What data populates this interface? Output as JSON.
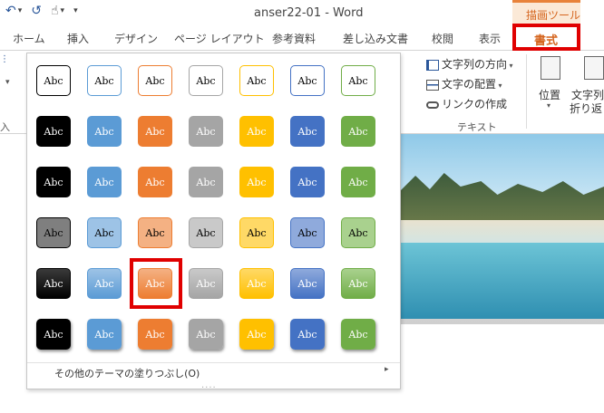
{
  "window": {
    "title": "anser22-01 - Word",
    "context_group": "描画ツール"
  },
  "qat": {
    "undo": "↶",
    "redo": "↺",
    "touch": "☝",
    "more": "▾"
  },
  "tabs": [
    "ホーム",
    "挿入",
    "デザイン",
    "ページ レイアウト",
    "参考資料",
    "差し込み文書",
    "校閲",
    "表示"
  ],
  "active_tab": "書式",
  "ribbon": {
    "text_direction": "文字列の方向",
    "text_align": "文字の配置",
    "create_link": "リンクの作成",
    "text_group": "テキスト",
    "position": "位置",
    "wrap_line1": "文字列",
    "wrap_line2": "折り返し",
    "left_frag": "入"
  },
  "gallery": {
    "swatch_text": "Abc",
    "more_fills": "その他のテーマの塗りつぶし(O)",
    "grip": "....",
    "colors": [
      "#000000",
      "#5b9bd5",
      "#ed7d31",
      "#a5a5a5",
      "#ffc000",
      "#4472c4",
      "#70ad47"
    ],
    "light_colors": [
      "#7f7f7f",
      "#9dc3e6",
      "#f4b183",
      "#c9c9c9",
      "#ffd966",
      "#8faadc",
      "#a9d18e"
    ]
  },
  "selected": {
    "row": 5,
    "col": 3
  }
}
